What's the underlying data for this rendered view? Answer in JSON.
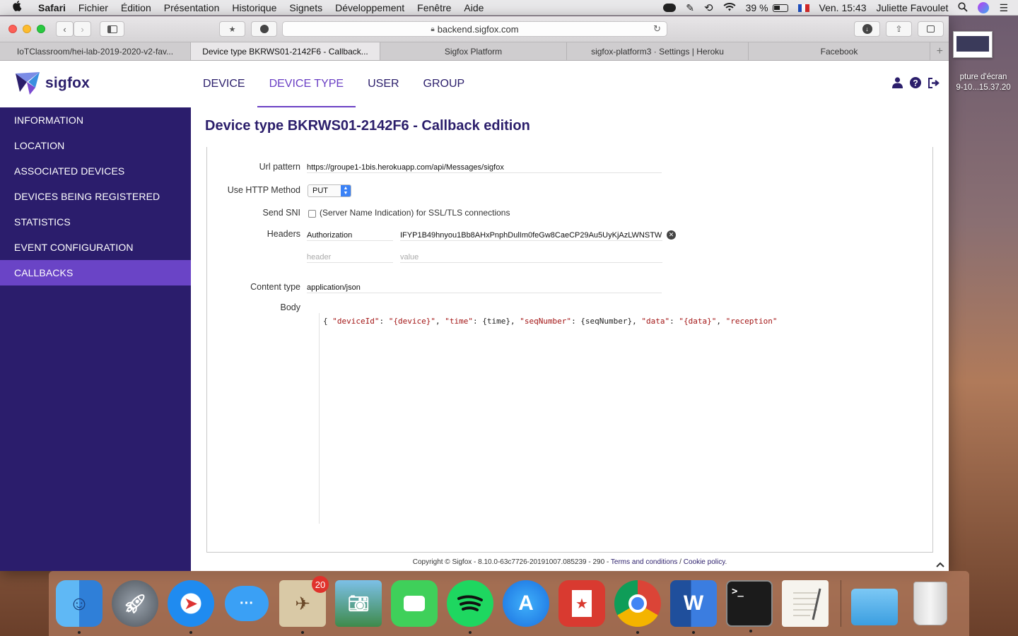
{
  "menubar": {
    "app_name": "Safari",
    "items": [
      "Fichier",
      "Édition",
      "Présentation",
      "Historique",
      "Signets",
      "Développement",
      "Fenêtre",
      "Aide"
    ],
    "battery": "39 %",
    "clock": "Ven. 15:43",
    "user": "Juliette Favoulet"
  },
  "browser": {
    "url": "backend.sigfox.com",
    "tabs": [
      "IoTClassroom/hei-lab-2019-2020-v2-fav...",
      "Device type BKRWS01-2142F6 - Callback...",
      "Sigfox Platform",
      "sigfox-platform3 · Settings | Heroku",
      "Facebook"
    ]
  },
  "app": {
    "logo_text": "sigfox",
    "nav": [
      "DEVICE",
      "DEVICE TYPE",
      "USER",
      "GROUP"
    ],
    "sidebar": [
      "INFORMATION",
      "LOCATION",
      "ASSOCIATED DEVICES",
      "DEVICES BEING REGISTERED",
      "STATISTICS",
      "EVENT CONFIGURATION",
      "CALLBACKS"
    ],
    "page_title": "Device type BKRWS01-2142F6 - Callback edition"
  },
  "form": {
    "url_pattern_label": "Url pattern",
    "url_pattern_value": "https://groupe1-1bis.herokuapp.com/api/Messages/sigfox",
    "http_method_label": "Use HTTP Method",
    "http_method_value": "PUT",
    "send_sni_label": "Send SNI",
    "send_sni_text": "(Server Name Indication) for SSL/TLS connections",
    "headers_label": "Headers",
    "header_name": "Authorization",
    "header_value": "IFYP1B49hnyou1Bb8AHxPnphDulIm0feGw8CaeCP29Au5UyKjAzLWNSTW",
    "header_placeholder": "header",
    "value_placeholder": "value",
    "content_type_label": "Content type",
    "content_type_value": "application/json",
    "body_label": "Body",
    "body_code": {
      "p0": "{ ",
      "k1": "\"deviceId\"",
      "p1": ": ",
      "v1": "\"{device}\"",
      "p2": ", ",
      "k2": "\"time\"",
      "p3": ": {time}, ",
      "k3": "\"seqNumber\"",
      "p4": ": {seqNumber}, ",
      "k4": "\"data\"",
      "p5": ": ",
      "v4": "\"{data}\"",
      "p6": ", ",
      "k5": "\"reception\""
    }
  },
  "footer": {
    "copyright": "Copyright © Sigfox - 8.10.0-63c7726-20191007.085239 - 290 - ",
    "terms": "Terms and conditions",
    "sep": " / ",
    "cookie": "Cookie policy",
    "end": "."
  },
  "desktop": {
    "screenshot_label_1": "pture d'écran",
    "screenshot_label_2": "9-10...15.37.20"
  },
  "dock": {
    "mail_badge": "20",
    "word_letter": "W",
    "terminal_prompt": ">_"
  },
  "colors": {
    "brand_dark": "#2b1e6b",
    "brand_accent": "#6a44c6",
    "code_key": "#a31515"
  }
}
